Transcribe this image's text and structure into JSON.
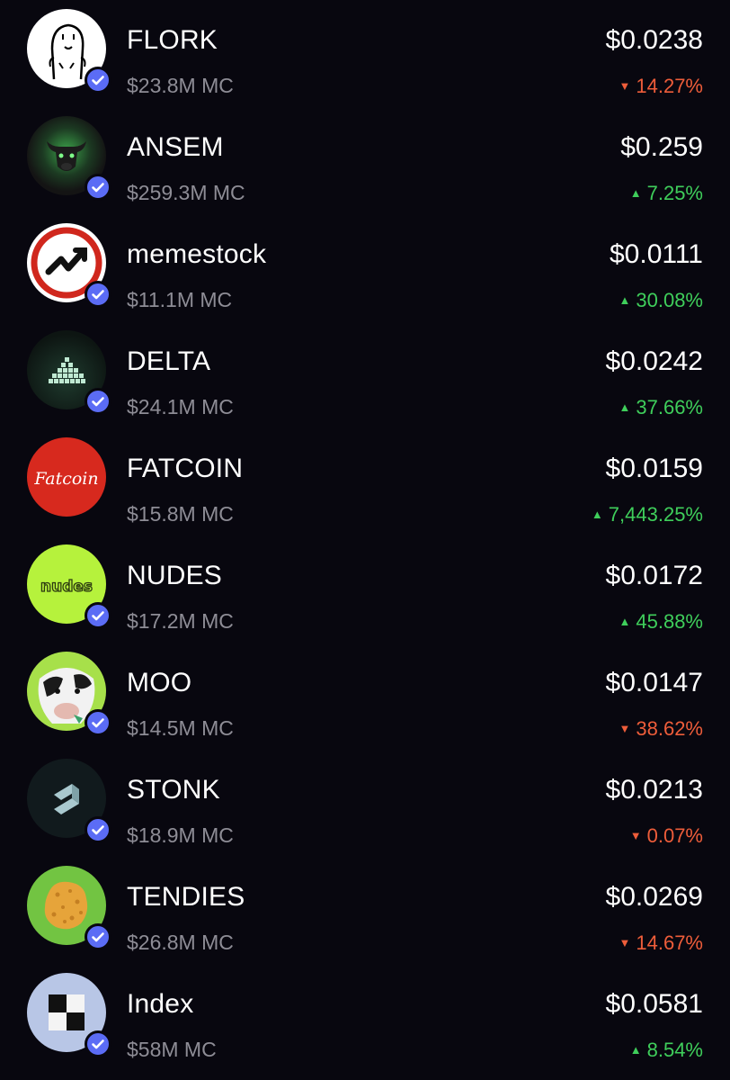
{
  "tokens": [
    {
      "name": "FLORK",
      "market_cap": "$23.8M MC",
      "price": "$0.0238",
      "change": "14.27%",
      "direction": "down",
      "icon": "flork-meme-icon",
      "verified": true
    },
    {
      "name": "ANSEM",
      "market_cap": "$259.3M MC",
      "price": "$0.259",
      "change": "7.25%",
      "direction": "up",
      "icon": "bull-head-icon",
      "verified": true
    },
    {
      "name": "memestock",
      "market_cap": "$11.1M MC",
      "price": "$0.0111",
      "change": "30.08%",
      "direction": "up",
      "icon": "trend-arrow-icon",
      "verified": true
    },
    {
      "name": "DELTA",
      "market_cap": "$24.1M MC",
      "price": "$0.0242",
      "change": "37.66%",
      "direction": "up",
      "icon": "pyramid-blocks-icon",
      "verified": true
    },
    {
      "name": "FATCOIN",
      "market_cap": "$15.8M MC",
      "price": "$0.0159",
      "change": "7,443.25%",
      "direction": "up",
      "icon": "fatcoin-logo-icon",
      "icon_text": "Fatcoin",
      "verified": false
    },
    {
      "name": "NUDES",
      "market_cap": "$17.2M MC",
      "price": "$0.0172",
      "change": "45.88%",
      "direction": "up",
      "icon": "nudes-logo-icon",
      "icon_text": "nudes",
      "verified": true
    },
    {
      "name": "MOO",
      "market_cap": "$14.5M MC",
      "price": "$0.0147",
      "change": "38.62%",
      "direction": "down",
      "icon": "cow-icon",
      "verified": true
    },
    {
      "name": "STONK",
      "market_cap": "$18.9M MC",
      "price": "$0.0213",
      "change": "0.07%",
      "direction": "down",
      "icon": "stonk-logo-icon",
      "verified": true
    },
    {
      "name": "TENDIES",
      "market_cap": "$26.8M MC",
      "price": "$0.0269",
      "change": "14.67%",
      "direction": "down",
      "icon": "chicken-tender-icon",
      "verified": true
    },
    {
      "name": "Index",
      "market_cap": "$58M MC",
      "price": "$0.0581",
      "change": "8.54%",
      "direction": "up",
      "icon": "checker-squares-icon",
      "verified": true
    }
  ],
  "colors": {
    "background": "#08070f",
    "up": "#3fce5b",
    "down": "#ee5d3a",
    "muted": "#8e8d96",
    "verified": "#5b6cf5"
  },
  "glyphs": {
    "up_arrow": "▲",
    "down_arrow": "▼"
  }
}
